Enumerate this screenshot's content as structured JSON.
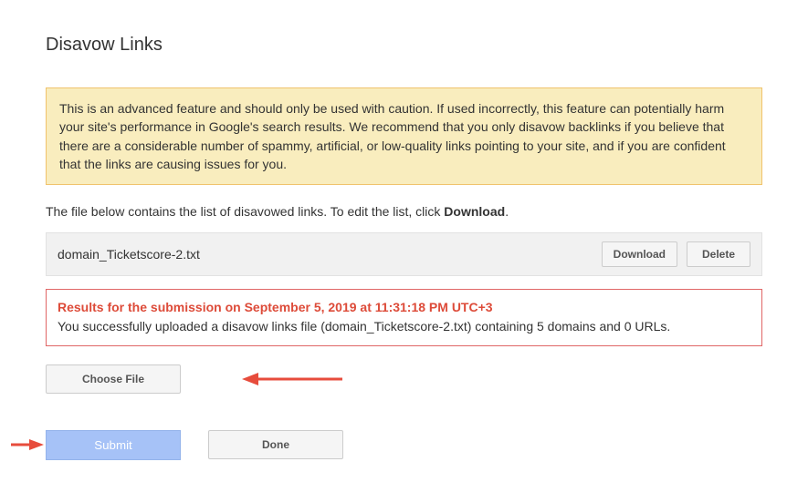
{
  "page_title": "Disavow Links",
  "warning_text": "This is an advanced feature and should only be used with caution. If used incorrectly, this feature can potentially harm your site's performance in Google's search results. We recommend that you only disavow backlinks if you believe that there are a considerable number of spammy, artificial, or low-quality links pointing to your site, and if you are confident that the links are causing issues for you.",
  "instruction_prefix": "The file below contains the list of disavowed links. To edit the list, click ",
  "instruction_bold": "Download",
  "instruction_suffix": ".",
  "file_name": "domain_Ticketscore-2.txt",
  "buttons": {
    "download": "Download",
    "delete": "Delete",
    "choose_file": "Choose File",
    "submit": "Submit",
    "done": "Done"
  },
  "result": {
    "heading": "Results for the submission on September 5, 2019 at 11:31:18 PM UTC+3",
    "body": "You successfully uploaded a disavow links file (domain_Ticketscore-2.txt) containing 5 domains and 0 URLs."
  },
  "colors": {
    "arrow": "#e74c3c"
  }
}
